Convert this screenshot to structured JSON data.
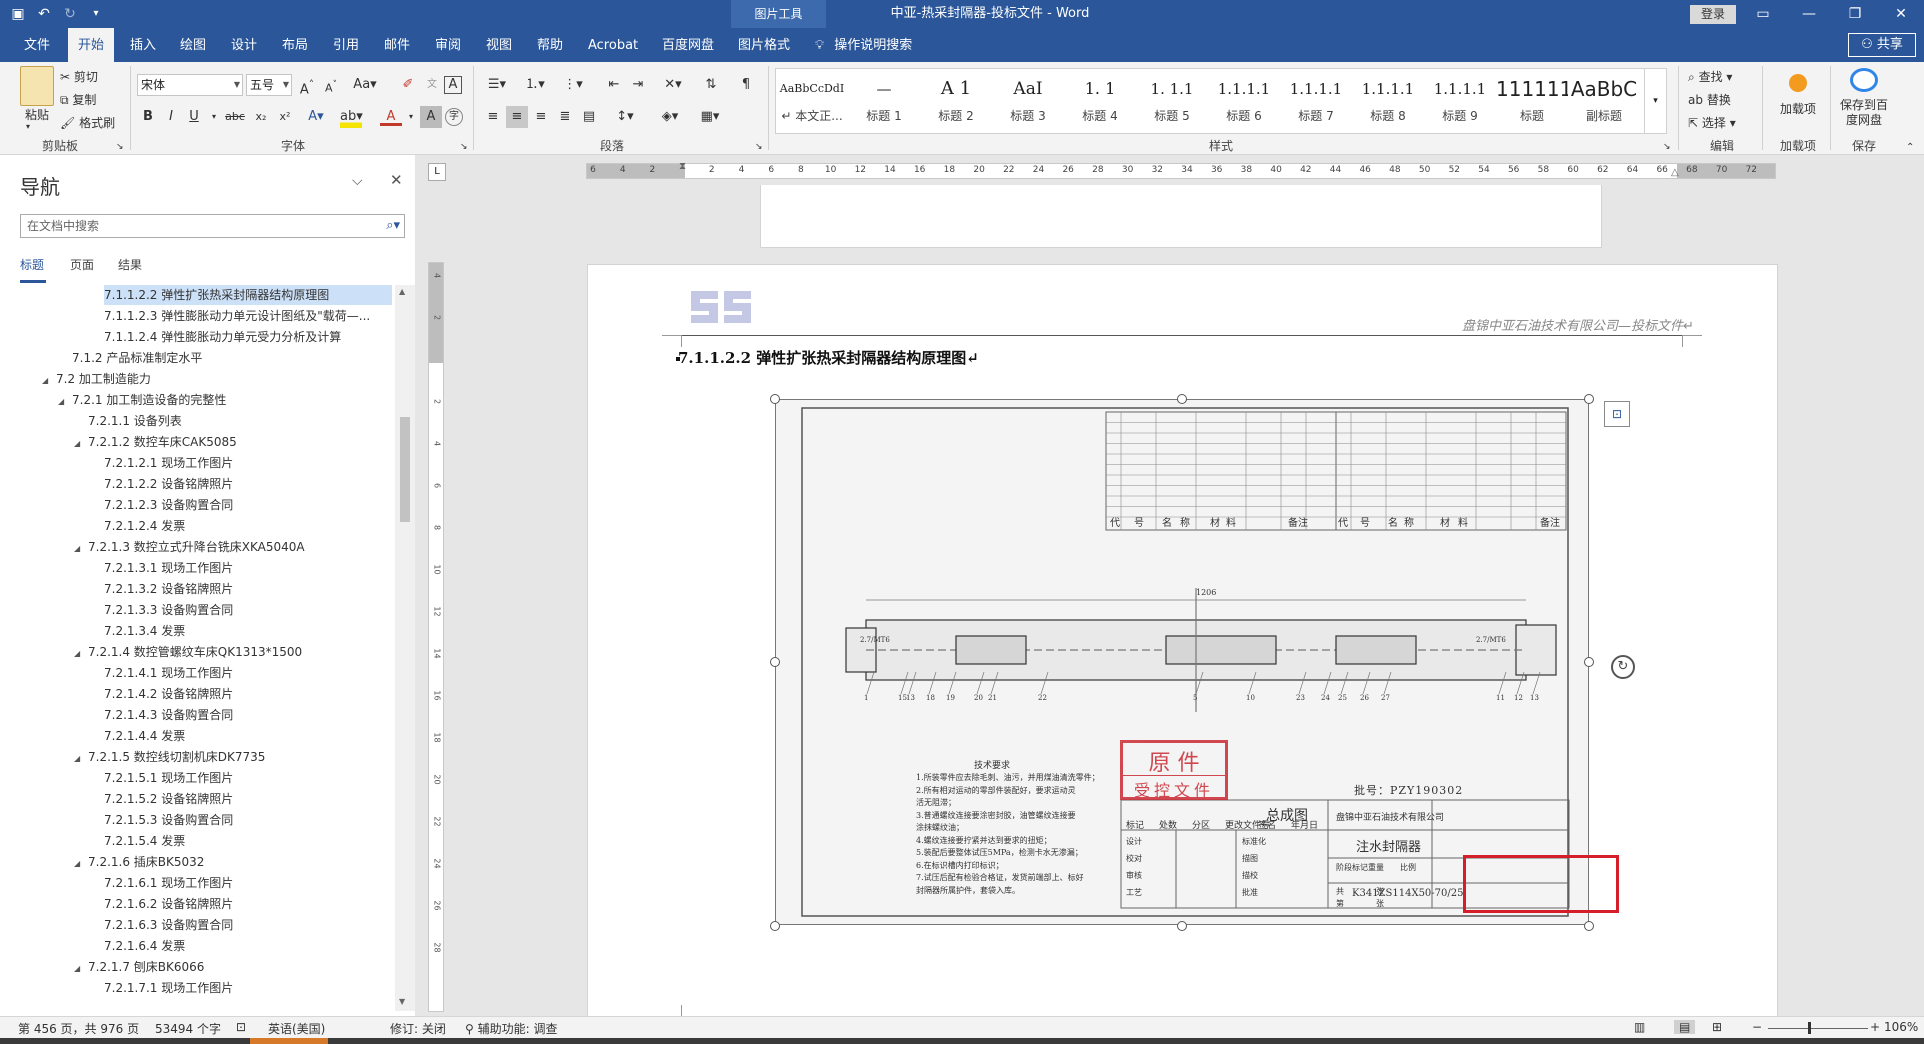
{
  "titlebar": {
    "context_tab": "图片工具",
    "doc_title": "中亚-热采封隔器-投标文件  -  Word",
    "login": "登录",
    "icons": [
      "save-icon",
      "undo-icon",
      "redo-icon",
      "customize-icon"
    ]
  },
  "ribbon_tabs": {
    "tabs": [
      "文件",
      "开始",
      "插入",
      "绘图",
      "设计",
      "布局",
      "引用",
      "邮件",
      "审阅",
      "视图",
      "帮助",
      "Acrobat",
      "百度网盘",
      "图片格式"
    ],
    "active": "开始",
    "tell_me": "操作说明搜索",
    "share": "共享"
  },
  "ribbon": {
    "clipboard": {
      "paste": "粘贴",
      "cut": "剪切",
      "copy": "复制",
      "format_painter": "格式刷",
      "label": "剪贴板"
    },
    "font": {
      "name": "宋体",
      "size": "五号",
      "label": "字体"
    },
    "paragraph": {
      "label": "段落"
    },
    "styles": {
      "label": "样式",
      "items": [
        {
          "preview": "AaBbCcDdI",
          "name": "↵ 本文正..."
        },
        {
          "preview": "—",
          "name": "标题 1"
        },
        {
          "preview": "A  1",
          "name": "标题 2"
        },
        {
          "preview": "AaI",
          "name": "标题 3"
        },
        {
          "preview": "1.  1",
          "name": "标题 4"
        },
        {
          "preview": "1. 1.1",
          "name": "标题 5"
        },
        {
          "preview": "1.1.1.1",
          "name": "标题 6"
        },
        {
          "preview": "1.1.1.1",
          "name": "标题 7"
        },
        {
          "preview": "1.1.1.1",
          "name": "标题 8"
        },
        {
          "preview": "1.1.1.1",
          "name": "标题 9"
        },
        {
          "preview": "111111",
          "name": "标题"
        },
        {
          "preview": "AaBbC",
          "name": "副标题"
        }
      ]
    },
    "editing": {
      "find": "查找",
      "replace": "替换",
      "select": "选择",
      "label": "编辑"
    },
    "addins": {
      "button": "加载项",
      "label": "加载项"
    },
    "save": {
      "button": "保存到百度网盘",
      "label": "保存"
    }
  },
  "navigation": {
    "title": "导航",
    "search_placeholder": "在文档中搜索",
    "tabs": [
      "标题",
      "页面",
      "结果"
    ],
    "active_tab": "标题",
    "items": [
      {
        "text": "7.1.1.2.2 弹性扩张热采封隔器结构原理图",
        "level": 4,
        "selected": true
      },
      {
        "text": "7.1.1.2.3 弹性膨胀动力单元设计图纸及\"载荷—...",
        "level": 4
      },
      {
        "text": "7.1.1.2.4 弹性膨胀动力单元受力分析及计算",
        "level": 4
      },
      {
        "text": "7.1.2 产品标准制定水平",
        "level": 2
      },
      {
        "text": "7.2 加工制造能力",
        "level": 1,
        "expanded": true
      },
      {
        "text": "7.2.1 加工制造设备的完整性",
        "level": 2,
        "expanded": true
      },
      {
        "text": "7.2.1.1 设备列表",
        "level": 3
      },
      {
        "text": "7.2.1.2 数控车床CAK5085",
        "level": 3,
        "expanded": true
      },
      {
        "text": "7.2.1.2.1 现场工作图片",
        "level": 4
      },
      {
        "text": "7.2.1.2.2 设备铭牌照片",
        "level": 4
      },
      {
        "text": "7.2.1.2.3 设备购置合同",
        "level": 4
      },
      {
        "text": "7.2.1.2.4 发票",
        "level": 4
      },
      {
        "text": "7.2.1.3 数控立式升降台铣床XKA5040A",
        "level": 3,
        "expanded": true
      },
      {
        "text": "7.2.1.3.1 现场工作图片",
        "level": 4
      },
      {
        "text": "7.2.1.3.2 设备铭牌照片",
        "level": 4
      },
      {
        "text": "7.2.1.3.3 设备购置合同",
        "level": 4
      },
      {
        "text": "7.2.1.3.4 发票",
        "level": 4
      },
      {
        "text": "7.2.1.4 数控管螺纹车床QK1313*1500",
        "level": 3,
        "expanded": true
      },
      {
        "text": "7.2.1.4.1 现场工作图片",
        "level": 4
      },
      {
        "text": "7.2.1.4.2 设备铭牌照片",
        "level": 4
      },
      {
        "text": "7.2.1.4.3 设备购置合同",
        "level": 4
      },
      {
        "text": "7.2.1.4.4 发票",
        "level": 4
      },
      {
        "text": "7.2.1.5 数控线切割机床DK7735",
        "level": 3,
        "expanded": true
      },
      {
        "text": "7.2.1.5.1 现场工作图片",
        "level": 4
      },
      {
        "text": "7.2.1.5.2 设备铭牌照片",
        "level": 4
      },
      {
        "text": "7.2.1.5.3 设备购置合同",
        "level": 4
      },
      {
        "text": "7.2.1.5.4 发票",
        "level": 4
      },
      {
        "text": "7.2.1.6 插床BK5032",
        "level": 3,
        "expanded": true
      },
      {
        "text": "7.2.1.6.1 现场工作图片",
        "level": 4
      },
      {
        "text": "7.2.1.6.2 设备铭牌照片",
        "level": 4
      },
      {
        "text": "7.2.1.6.3 设备购置合同",
        "level": 4
      },
      {
        "text": "7.2.1.6.4 发票",
        "level": 4
      },
      {
        "text": "7.2.1.7 刨床BK6066",
        "level": 3,
        "expanded": true
      },
      {
        "text": "7.2.1.7.1 现场工作图片",
        "level": 4
      }
    ]
  },
  "rulers": {
    "horizontal_ticks": [
      "6",
      "4",
      "2",
      "",
      "2",
      "4",
      "6",
      "8",
      "10",
      "12",
      "14",
      "16",
      "18",
      "20",
      "22",
      "24",
      "26",
      "28",
      "30",
      "32",
      "34",
      "36",
      "38",
      "40",
      "42",
      "44",
      "46",
      "48",
      "50",
      "52",
      "54",
      "56",
      "58",
      "60",
      "62",
      "64",
      "66",
      "68",
      "70",
      "72"
    ],
    "vertical_ticks": [
      "4",
      "2",
      "",
      "2",
      "4",
      "6",
      "8",
      "10",
      "12",
      "14",
      "16",
      "18",
      "20",
      "22",
      "24",
      "26",
      "28"
    ],
    "corner": "L"
  },
  "document": {
    "company_header": "盘锦中亚石油技术有限公司—投标文件↵",
    "heading": "7.1.1.2.2 弹性扩张热采封隔器结构原理图↵",
    "drawing": {
      "table_headers": [
        "代",
        "号",
        "名",
        "称",
        "材",
        "料",
        "备注",
        "代",
        "号",
        "名",
        "称",
        "材",
        "料",
        "备注"
      ],
      "dimension": "1206",
      "tech_title": "技术要求",
      "tech_lines": [
        "1.所装零件应去除毛刺、油污，并用煤油清洗零件；",
        "2.所有相对运动的零部件装配好，要求运动灵",
        "  活无阻滞；",
        "3.普通螺纹连接要涂密封胶，油管螺纹连接要",
        "  涂抹螺纹油；",
        "4.螺纹连接要拧紧并达到要求的扭矩；",
        "5.装配后要整体试压5MPa，检测卡水无渗漏；",
        "6.在标识槽内打印标识；",
        "7.试压后配有检验合格证，发货前端部上、标好",
        "  封隔器所属护件，套袋入库。"
      ],
      "stamp_top": "原  件",
      "stamp_bottom": "受控文件",
      "batch_no": "批号：PZY190302",
      "title_block": {
        "assembly": "总成图",
        "company": "盘锦中亚石油技术有限公司",
        "product": "注水封隔器",
        "model": "K341ZS114X50-70/25",
        "row_labels": [
          "标记",
          "处数",
          "分区",
          "更改文件号",
          "签名",
          "年月日"
        ],
        "left_labels": [
          "设计",
          "校对",
          "审核",
          "工艺"
        ],
        "mid_labels": [
          "标准化",
          "描图",
          "描校",
          "批准"
        ],
        "stage_labels": [
          "阶段标记",
          "重量",
          "比例"
        ],
        "sheet_labels": [
          "共",
          "张",
          "第",
          "张"
        ]
      },
      "part_labels": [
        "1",
        "15",
        "13",
        "18",
        "19",
        "20",
        "21",
        "22",
        "5",
        "10",
        "23",
        "24",
        "25",
        "26",
        "27",
        "11",
        "12",
        "13"
      ],
      "tag_left": "2.7/MT6",
      "tag_right": "2.7/MT6"
    }
  },
  "statusbar": {
    "page": "第 456 页，共 976 页",
    "words": "53494 个字",
    "language": "英语(美国)",
    "track_changes": "修订: 关闭",
    "accessibility": "辅助功能: 调查",
    "zoom": "106%"
  },
  "colors": {
    "accent": "#2b579a",
    "highlight": "#cce0f7",
    "callout": "#d41f2a",
    "stamp": "#cc2a33"
  }
}
